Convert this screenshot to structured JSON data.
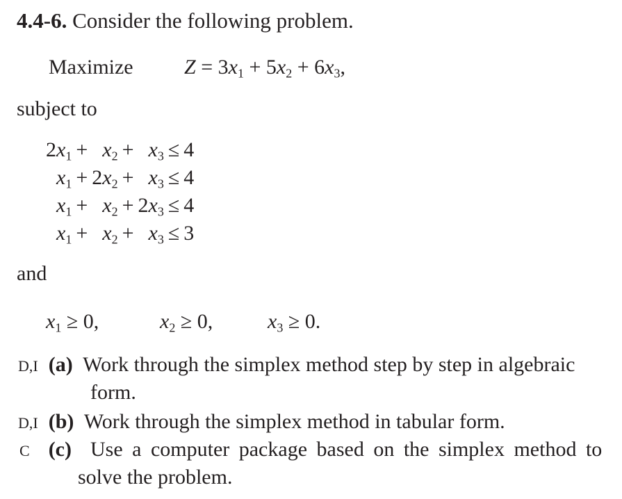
{
  "problem": {
    "number": "4.4-6.",
    "intro": "Consider the following problem.",
    "maximize_label": "Maximize",
    "objective": {
      "lhs": "Z",
      "eq": "=",
      "terms": [
        {
          "coef": "3",
          "var": "x",
          "sub": "1",
          "op": "+"
        },
        {
          "coef": "5",
          "var": "x",
          "sub": "2",
          "op": "+"
        },
        {
          "coef": "6",
          "var": "x",
          "sub": "3",
          "op": ","
        }
      ]
    },
    "subject_to": "subject to",
    "constraints": [
      {
        "c1": "2",
        "c2": "",
        "c3": "",
        "rel": "≤",
        "rhs": "4"
      },
      {
        "c1": "",
        "c2": "2",
        "c3": "",
        "rel": "≤",
        "rhs": "4"
      },
      {
        "c1": "",
        "c2": "",
        "c3": "2",
        "rel": "≤",
        "rhs": "4"
      },
      {
        "c1": "",
        "c2": "",
        "c3": "",
        "rel": "≤",
        "rhs": "3"
      }
    ],
    "and_label": "and",
    "nonnegativity": [
      {
        "var": "x",
        "sub": "1",
        "text": "≥ 0,"
      },
      {
        "var": "x",
        "sub": "2",
        "text": "≥ 0,"
      },
      {
        "var": "x",
        "sub": "3",
        "text": "≥ 0."
      }
    ],
    "parts": [
      {
        "tag": "D,I",
        "label": "(a)",
        "text": "Work through the simplex method step by step in algebraic",
        "cont": "form."
      },
      {
        "tag": "D,I",
        "label": "(b)",
        "text": "Work through the simplex method in tabular form.",
        "cont": ""
      },
      {
        "tag": "C",
        "label": "(c)",
        "text": "Use a computer package based on the simplex method to",
        "cont": "solve the problem."
      }
    ]
  }
}
